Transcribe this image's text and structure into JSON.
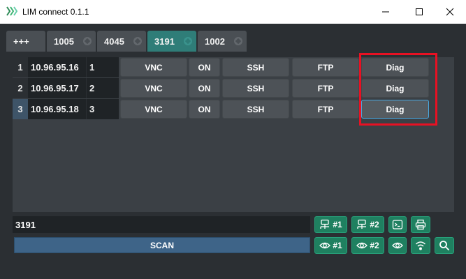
{
  "window": {
    "title": "LIM connect 0.1.1",
    "icon": "lim-logo-icon",
    "controls": [
      "minimize-icon",
      "maximize-icon",
      "close-icon"
    ]
  },
  "tabs": [
    {
      "label": "+++",
      "active": false
    },
    {
      "label": "1005",
      "active": false
    },
    {
      "label": "4045",
      "active": false
    },
    {
      "label": "3191",
      "active": true
    },
    {
      "label": "1002",
      "active": false
    }
  ],
  "hosts": [
    {
      "row": "1",
      "ip": "10.96.95.16",
      "index": "1",
      "selected": false
    },
    {
      "row": "2",
      "ip": "10.96.95.17",
      "index": "2",
      "selected": false
    },
    {
      "row": "3",
      "ip": "10.96.95.18",
      "index": "3",
      "selected": true
    }
  ],
  "host_buttons": {
    "vnc": "VNC",
    "on": "ON",
    "ssh": "SSH",
    "ftp": "FTP",
    "diag": "Diag"
  },
  "input": {
    "value": "3191"
  },
  "scan_label": "SCAN",
  "tools_row1": [
    {
      "icon": "network-icon",
      "label": "#1"
    },
    {
      "icon": "network-icon",
      "label": "#2"
    },
    {
      "icon": "terminal-icon",
      "label": ""
    },
    {
      "icon": "printer-icon",
      "label": ""
    }
  ],
  "tools_row2": [
    {
      "icon": "eye-icon",
      "label": "#1"
    },
    {
      "icon": "eye-icon",
      "label": "#2"
    },
    {
      "icon": "eye-icon",
      "label": ""
    },
    {
      "icon": "wifi-icon",
      "label": ""
    },
    {
      "icon": "search-icon",
      "label": ""
    }
  ],
  "colors": {
    "background": "#2b2f33",
    "active_tab": "#2f7d78",
    "tool_button": "#1f8060",
    "scan_button": "#3e6488",
    "highlight": "#e81123"
  }
}
